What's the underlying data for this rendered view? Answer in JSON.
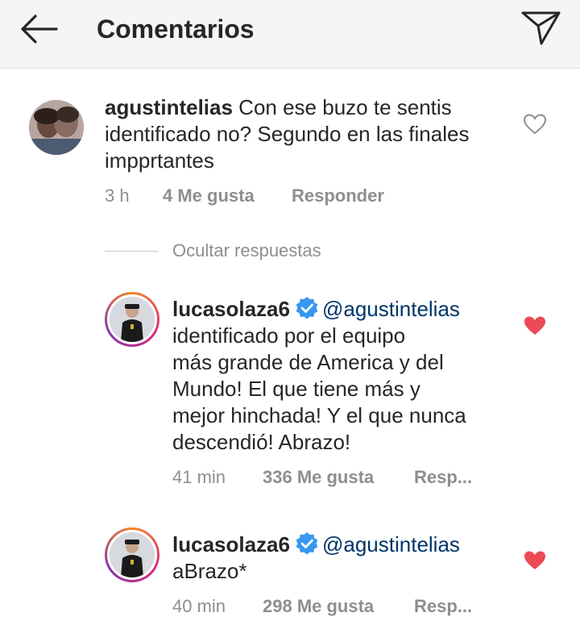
{
  "header": {
    "title": "Comentarios"
  },
  "comments": [
    {
      "username": "agustintelias",
      "text_lines": [
        "Con ese buzo te sentis",
        "identificado no? Segundo en las finales",
        "impprtantes"
      ],
      "time": "3 h",
      "likes": "4 Me gusta",
      "reply": "Responder",
      "liked": false
    }
  ],
  "hide_replies_label": "Ocultar respuestas",
  "replies": [
    {
      "username": "lucasolaza6",
      "mention": "@agustintelias",
      "text_lines": [
        "identificado por el equipo",
        "más grande de America y del",
        "Mundo! El que tiene más y",
        "mejor hinchada! Y el que nunca",
        "descendió! Abrazo!"
      ],
      "time": "41 min",
      "likes": "336 Me gusta",
      "reply": "Resp...",
      "liked": true
    },
    {
      "username": "lucasolaza6",
      "mention": "@agustintelias",
      "text_lines": [
        "aBrazo*"
      ],
      "time": "40 min",
      "likes": "298 Me gusta",
      "reply": "Resp...",
      "liked": true
    }
  ],
  "colors": {
    "liked_heart": "#ed4956",
    "verified": "#3897f0",
    "mention": "#003569",
    "meta": "#8e8e8e"
  },
  "icons": {
    "back": "arrow-left-icon",
    "send": "paper-plane-icon",
    "heart": "heart-icon",
    "verified": "verified-badge-icon"
  }
}
